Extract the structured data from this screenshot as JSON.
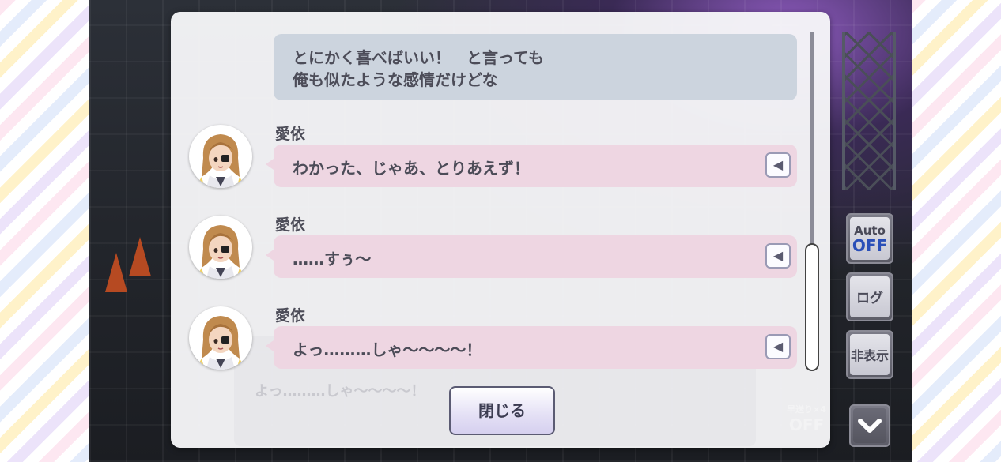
{
  "dialog": {
    "own_message_line1": "とにかく喜べばいい！　と言っても",
    "own_message_line2": "俺も似たような感情だけどな",
    "entries": [
      {
        "speaker": "愛依",
        "text": "わかった、じゃあ、とりあえず！"
      },
      {
        "speaker": "愛依",
        "text": "……すぅ～"
      },
      {
        "speaker": "愛依",
        "text": "よっ………しゃ～～～～！"
      }
    ],
    "close_label": "閉じる",
    "background_text": "よっ………しゃ～～～～！"
  },
  "side_controls": {
    "auto_label": "Auto",
    "auto_state": "OFF",
    "log_label": "ログ",
    "hide_label": "非表示",
    "skip_label": "早送り×4",
    "skip_state": "OFF"
  },
  "colors": {
    "bubble_pink": "#eed6e2",
    "bubble_self": "#ccd4de",
    "auto_off_blue": "#2a4fb8"
  }
}
